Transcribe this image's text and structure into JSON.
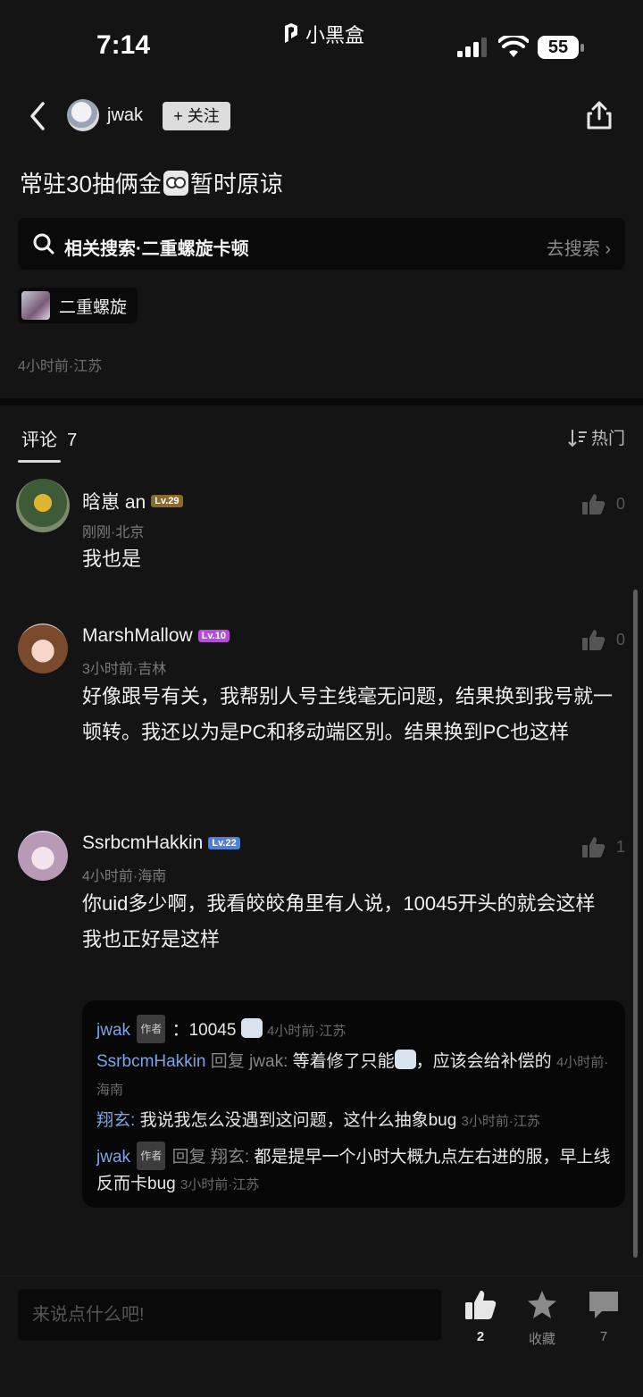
{
  "status_bar": {
    "time": "7:14",
    "brand": "小黑盒",
    "battery": "55"
  },
  "nav": {
    "username": "jwak",
    "follow_label": "+ 关注"
  },
  "post": {
    "title_before": "常驻30抽俩金",
    "title_after": "暂时原谅",
    "related_search": "相关搜索·二重螺旋卡顿",
    "search_action": "去搜索 ›",
    "tag": "二重螺旋",
    "meta": "4小时前·江苏"
  },
  "comments_header": {
    "tab_label": "评论",
    "count": "7",
    "sort_label": "热门"
  },
  "comments": [
    {
      "name": "晗崽 an",
      "level": "Lv.29",
      "meta": "刚刚·北京",
      "text": "我也是",
      "likes": "0"
    },
    {
      "name": "MarshMallow",
      "level": "Lv.10",
      "meta": "3小时前·吉林",
      "text": "好像跟号有关，我帮别人号主线毫无问题，结果换到我号就一顿转。我还以为是PC和移动端区别。结果换到PC也这样",
      "likes": "0"
    },
    {
      "name": "SsrbcmHakkin",
      "level": "Lv.22",
      "meta": "4小时前·海南",
      "text": "你uid多少啊，我看皎皎角里有人说，10045开头的就会这样\n我也正好是这样",
      "likes": "1"
    }
  ],
  "replies": [
    {
      "user": "jwak",
      "badge": "作者",
      "sep": "：",
      "text": "10045",
      "meta": "4小时前·江苏"
    },
    {
      "user": "SsrbcmHakkin",
      "reply_word": "回复",
      "target": "jwak:",
      "text_before": "等着修了只能",
      "text_after": "，应该会给补偿的",
      "meta": "4小时前·海南"
    },
    {
      "user": "翔玄:",
      "text": "我说我怎么没遇到这问题，这什么抽象bug",
      "meta": "3小时前·江苏"
    },
    {
      "user": "jwak",
      "badge": "作者",
      "reply_word": "回复",
      "target": "翔玄:",
      "text": "都是提早一个小时大概九点左右进的服，早上线反而卡bug",
      "meta": "3小时前·江苏"
    }
  ],
  "bottom_bar": {
    "input_placeholder": "来说点什么吧!",
    "like_count": "2",
    "fav_label": "收藏",
    "comment_count": "7"
  },
  "colors": {
    "background": "#141414",
    "reply_user": "#7fa4e6",
    "lv29": "#8a6b2e",
    "lv10": "#b34fd6",
    "lv22": "#4f7fd6"
  }
}
